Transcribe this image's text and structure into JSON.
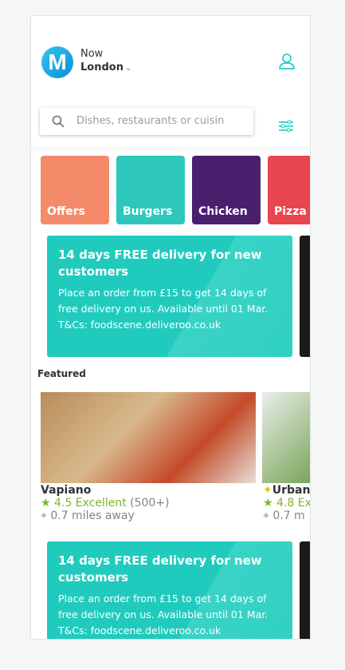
{
  "header": {
    "logo": "M",
    "time_label": "Now",
    "location": "London"
  },
  "search": {
    "placeholder": "Dishes, restaurants or cuisin"
  },
  "categories": [
    {
      "label": "Offers",
      "color": "#f48a6a"
    },
    {
      "label": "Burgers",
      "color": "#2dc7bb"
    },
    {
      "label": "Chicken",
      "color": "#4a1f6e"
    },
    {
      "label": "Pizza",
      "color": "#e8454f"
    }
  ],
  "promos": [
    {
      "title": "14 days FREE delivery for new customers",
      "body": "Place an order from £15 to get 14 days of free delivery on us. Available until 01 Mar. T&Cs: foodscene.deliveroo.co.uk"
    },
    {
      "title": "14 days FREE delivery for new customers",
      "body": "Place an order from £15 to get 14 days of free delivery on us. Available until 01 Mar. T&Cs: foodscene.deliveroo.co.uk"
    }
  ],
  "featured": {
    "heading": "Featured",
    "restaurants": [
      {
        "name": "Vapiano",
        "rating": "4.5 Excellent",
        "count": "(500+)",
        "distance": "0.7 miles away"
      },
      {
        "name": "Urban",
        "rating": "4.8 Ex",
        "distance": "0.7 m"
      }
    ]
  },
  "colors": {
    "accent": "#00ccbc",
    "rating": "#7bb52b"
  }
}
